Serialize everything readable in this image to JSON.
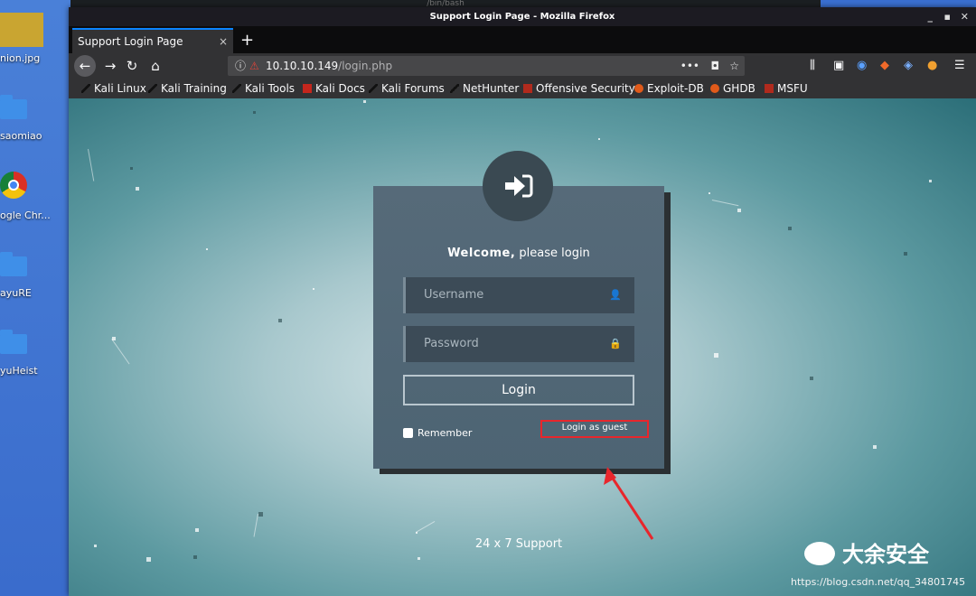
{
  "desktop": {
    "icons": [
      {
        "label": "nion.jpg",
        "kind": "image"
      },
      {
        "label": "saomiao",
        "kind": "folder"
      },
      {
        "label": "ogle Chr...",
        "kind": "chrome"
      },
      {
        "label": "ayuRE",
        "kind": "folder"
      },
      {
        "label": "yuHeist",
        "kind": "folder"
      }
    ]
  },
  "background_window": {
    "title": "/bin/bash"
  },
  "window": {
    "title": "Support Login Page - Mozilla Firefox",
    "tab": {
      "title": "Support Login Page",
      "close": "×"
    },
    "new_tab": "+",
    "url": {
      "host": "10.10.10.149",
      "path": "/login.php"
    },
    "url_more": "•••",
    "bookmarks": [
      "Kali Linux",
      "Kali Training",
      "Kali Tools",
      "Kali Docs",
      "Kali Forums",
      "NetHunter",
      "Offensive Security",
      "Exploit-DB",
      "GHDB",
      "MSFU"
    ]
  },
  "login": {
    "welcome_bold": "Welcome,",
    "welcome_rest": " please login",
    "username_placeholder": "Username",
    "password_placeholder": "Password",
    "login_button": "Login",
    "remember_label": "Remember",
    "guest_link": "Login as guest",
    "footer": "24 x 7 Support"
  },
  "colors": {
    "highlight_box": "#e8262c",
    "arrow": "#e8262c",
    "accent_tab": "#0a84ff"
  },
  "watermark": {
    "brand": "大余安全",
    "url": "https://blog.csdn.net/qq_34801745"
  }
}
